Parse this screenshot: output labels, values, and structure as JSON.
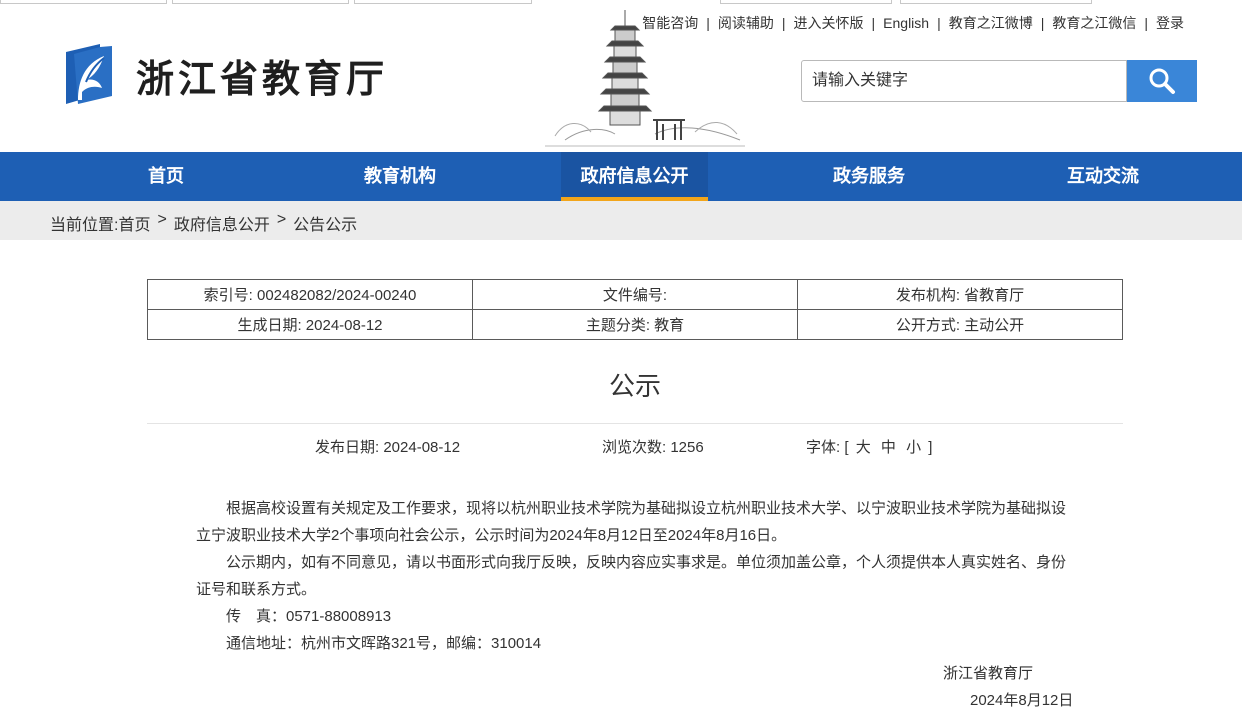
{
  "site": {
    "name": "浙江省教育厅"
  },
  "top_links": [
    "智能咨询",
    "阅读辅助",
    "进入关怀版",
    "English",
    "教育之江微博",
    "教育之江微信",
    "登录"
  ],
  "search": {
    "placeholder": "请输入关键字"
  },
  "nav": {
    "items": [
      "首页",
      "教育机构",
      "政府信息公开",
      "政务服务",
      "互动交流"
    ],
    "active": "政府信息公开"
  },
  "breadcrumb": {
    "prefix": "当前位置:",
    "items": [
      "首页",
      "政府信息公开",
      "公告公示"
    ],
    "separator": ">"
  },
  "meta": {
    "index_no": "索引号: 002482082/2024-00240",
    "doc_no": "文件编号:",
    "publisher": "发布机构: 省教育厅",
    "created": "生成日期: 2024-08-12",
    "category": "主题分类: 教育",
    "disclosure": "公开方式: 主动公开"
  },
  "article": {
    "title": "公示",
    "publish_date": "发布日期: 2024-08-12",
    "views": "浏览次数: 1256",
    "font_label": "字体: [",
    "font_large": "大",
    "font_medium": "中",
    "font_small": "小",
    "font_close": "]",
    "paragraphs": [
      "根据高校设置有关规定及工作要求，现将以杭州职业技术学院为基础拟设立杭州职业技术大学、以宁波职业技术学院为基础拟设立宁波职业技术大学2个事项向社会公示，公示时间为2024年8月12日至2024年8月16日。",
      "公示期内，如有不同意见，请以书面形式向我厅反映，反映内容应实事求是。单位须加盖公章，个人须提供本人真实姓名、身份证号和联系方式。",
      "传　真：0571-88008913",
      "通信地址：杭州市文晖路321号，邮编：310014"
    ],
    "signature": "浙江省教育厅",
    "sign_date": "2024年8月12日"
  },
  "colors": {
    "nav_bg": "#1e5fb4",
    "nav_active_underline": "#f2a51a",
    "search_button": "#3a86d8",
    "logo_blue": "#1e5fb4"
  }
}
